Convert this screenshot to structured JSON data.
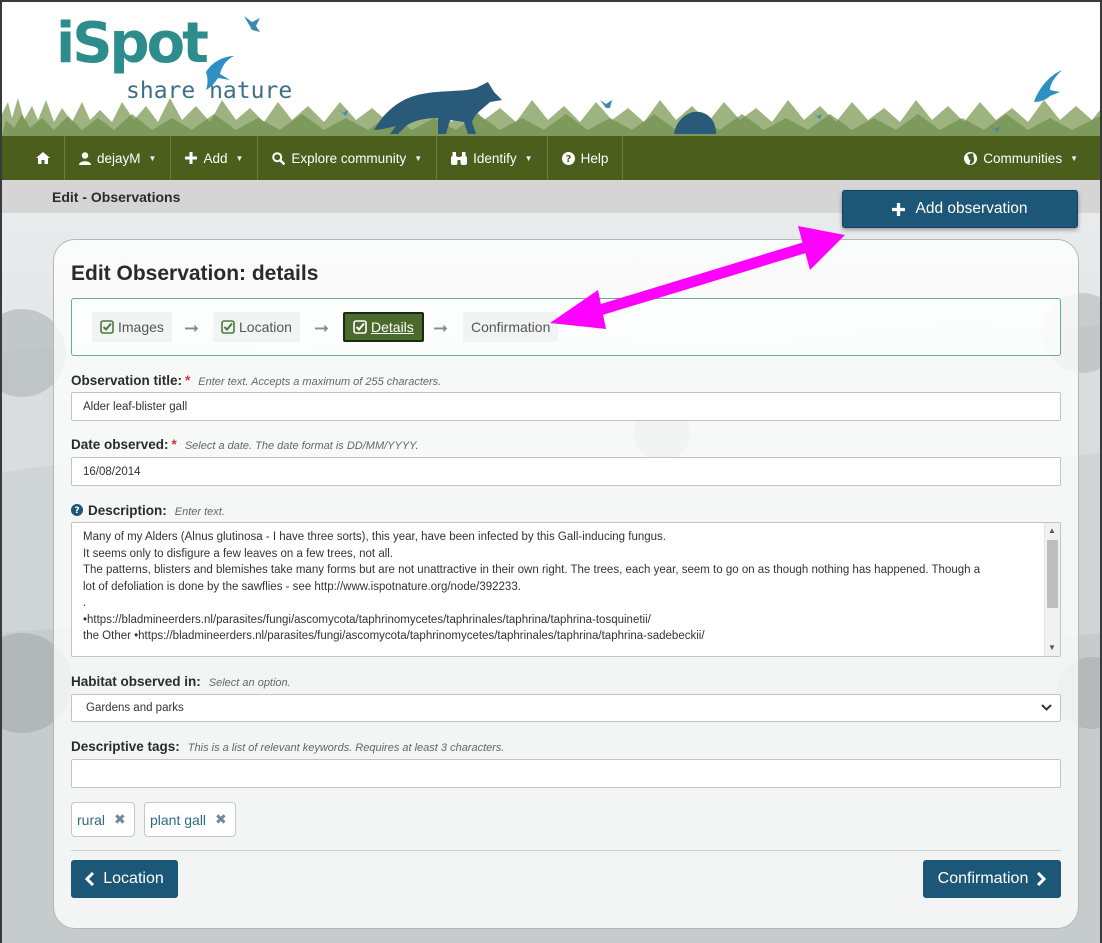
{
  "brand": {
    "logo_text": "iSpot",
    "tagline": "share nature"
  },
  "nav": {
    "user": "dejayM",
    "add": "Add",
    "explore": "Explore community",
    "identify": "Identify",
    "help": "Help",
    "communities": "Communities"
  },
  "breadcrumb": "Edit - Observations",
  "add_observation_label": "Add observation",
  "form": {
    "heading": "Edit Observation: details",
    "steps": [
      {
        "label": "Images",
        "done": true
      },
      {
        "label": "Location",
        "done": true
      },
      {
        "label": "Details",
        "done": true,
        "active": true
      },
      {
        "label": "Confirmation",
        "done": false
      }
    ],
    "title": {
      "label": "Observation title:",
      "hint": "Enter text. Accepts a maximum of 255 characters.",
      "value": "Alder leaf-blister gall"
    },
    "date": {
      "label": "Date observed:",
      "hint": "Select a date. The date format is DD/MM/YYYY.",
      "value": "16/08/2014"
    },
    "description": {
      "label": "Description:",
      "hint": "Enter text.",
      "lines": [
        "Many of my Alders (Alnus glutinosa - I have three sorts), this year, have been infected by this Gall-inducing fungus.",
        "It seems only to disfigure a few leaves on a few trees, not all.",
        "The patterns, blisters and blemishes take many forms but are not unattractive in their own right. The trees, each year, seem to go on as though nothing has happened. Though a",
        "lot of defoliation is done by the sawflies - see http://www.ispotnature.org/node/392233.",
        ".",
        "•https://bladmineerders.nl/parasites/fungi/ascomycota/taphrinomycetes/taphrinales/taphrina/taphrina-tosquinetii/",
        "the Other •https://bladmineerders.nl/parasites/fungi/ascomycota/taphrinomycetes/taphrinales/taphrina/taphrina-sadebeckii/"
      ]
    },
    "habitat": {
      "label": "Habitat observed in:",
      "hint": "Select an option.",
      "value": "Gardens and parks"
    },
    "tags": {
      "label": "Descriptive tags:",
      "hint": "This is a list of relevant keywords. Requires at least 3 characters.",
      "value": "",
      "items": [
        "rural",
        "plant gall"
      ]
    },
    "back_label": "Location",
    "next_label": "Confirmation"
  },
  "colors": {
    "nav_bg": "#4b5e1c",
    "primary_button": "#1d5778",
    "active_step": "#4b6a2e",
    "annotation_arrow": "#ff00ff",
    "required_mark": "#d03232"
  }
}
